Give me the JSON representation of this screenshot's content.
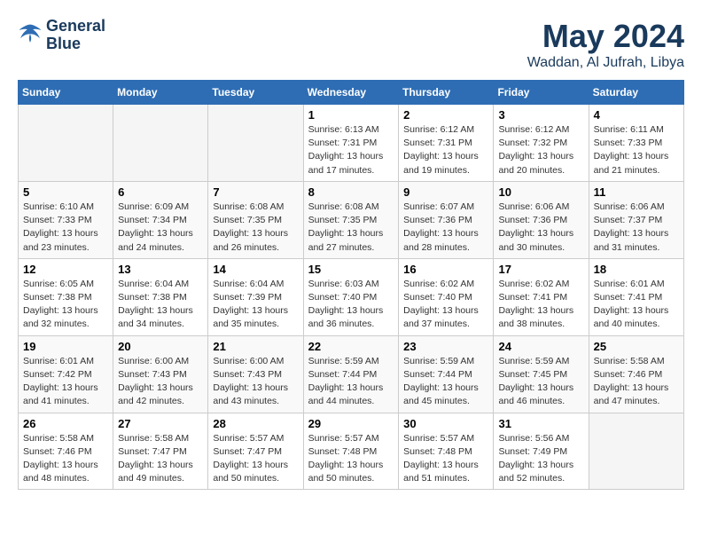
{
  "logo": {
    "line1": "General",
    "line2": "Blue"
  },
  "title": "May 2024",
  "location": "Waddan, Al Jufrah, Libya",
  "weekdays": [
    "Sunday",
    "Monday",
    "Tuesday",
    "Wednesday",
    "Thursday",
    "Friday",
    "Saturday"
  ],
  "weeks": [
    [
      {
        "day": "",
        "sunrise": "",
        "sunset": "",
        "daylight": ""
      },
      {
        "day": "",
        "sunrise": "",
        "sunset": "",
        "daylight": ""
      },
      {
        "day": "",
        "sunrise": "",
        "sunset": "",
        "daylight": ""
      },
      {
        "day": "1",
        "sunrise": "Sunrise: 6:13 AM",
        "sunset": "Sunset: 7:31 PM",
        "daylight": "Daylight: 13 hours and 17 minutes."
      },
      {
        "day": "2",
        "sunrise": "Sunrise: 6:12 AM",
        "sunset": "Sunset: 7:31 PM",
        "daylight": "Daylight: 13 hours and 19 minutes."
      },
      {
        "day": "3",
        "sunrise": "Sunrise: 6:12 AM",
        "sunset": "Sunset: 7:32 PM",
        "daylight": "Daylight: 13 hours and 20 minutes."
      },
      {
        "day": "4",
        "sunrise": "Sunrise: 6:11 AM",
        "sunset": "Sunset: 7:33 PM",
        "daylight": "Daylight: 13 hours and 21 minutes."
      }
    ],
    [
      {
        "day": "5",
        "sunrise": "Sunrise: 6:10 AM",
        "sunset": "Sunset: 7:33 PM",
        "daylight": "Daylight: 13 hours and 23 minutes."
      },
      {
        "day": "6",
        "sunrise": "Sunrise: 6:09 AM",
        "sunset": "Sunset: 7:34 PM",
        "daylight": "Daylight: 13 hours and 24 minutes."
      },
      {
        "day": "7",
        "sunrise": "Sunrise: 6:08 AM",
        "sunset": "Sunset: 7:35 PM",
        "daylight": "Daylight: 13 hours and 26 minutes."
      },
      {
        "day": "8",
        "sunrise": "Sunrise: 6:08 AM",
        "sunset": "Sunset: 7:35 PM",
        "daylight": "Daylight: 13 hours and 27 minutes."
      },
      {
        "day": "9",
        "sunrise": "Sunrise: 6:07 AM",
        "sunset": "Sunset: 7:36 PM",
        "daylight": "Daylight: 13 hours and 28 minutes."
      },
      {
        "day": "10",
        "sunrise": "Sunrise: 6:06 AM",
        "sunset": "Sunset: 7:36 PM",
        "daylight": "Daylight: 13 hours and 30 minutes."
      },
      {
        "day": "11",
        "sunrise": "Sunrise: 6:06 AM",
        "sunset": "Sunset: 7:37 PM",
        "daylight": "Daylight: 13 hours and 31 minutes."
      }
    ],
    [
      {
        "day": "12",
        "sunrise": "Sunrise: 6:05 AM",
        "sunset": "Sunset: 7:38 PM",
        "daylight": "Daylight: 13 hours and 32 minutes."
      },
      {
        "day": "13",
        "sunrise": "Sunrise: 6:04 AM",
        "sunset": "Sunset: 7:38 PM",
        "daylight": "Daylight: 13 hours and 34 minutes."
      },
      {
        "day": "14",
        "sunrise": "Sunrise: 6:04 AM",
        "sunset": "Sunset: 7:39 PM",
        "daylight": "Daylight: 13 hours and 35 minutes."
      },
      {
        "day": "15",
        "sunrise": "Sunrise: 6:03 AM",
        "sunset": "Sunset: 7:40 PM",
        "daylight": "Daylight: 13 hours and 36 minutes."
      },
      {
        "day": "16",
        "sunrise": "Sunrise: 6:02 AM",
        "sunset": "Sunset: 7:40 PM",
        "daylight": "Daylight: 13 hours and 37 minutes."
      },
      {
        "day": "17",
        "sunrise": "Sunrise: 6:02 AM",
        "sunset": "Sunset: 7:41 PM",
        "daylight": "Daylight: 13 hours and 38 minutes."
      },
      {
        "day": "18",
        "sunrise": "Sunrise: 6:01 AM",
        "sunset": "Sunset: 7:41 PM",
        "daylight": "Daylight: 13 hours and 40 minutes."
      }
    ],
    [
      {
        "day": "19",
        "sunrise": "Sunrise: 6:01 AM",
        "sunset": "Sunset: 7:42 PM",
        "daylight": "Daylight: 13 hours and 41 minutes."
      },
      {
        "day": "20",
        "sunrise": "Sunrise: 6:00 AM",
        "sunset": "Sunset: 7:43 PM",
        "daylight": "Daylight: 13 hours and 42 minutes."
      },
      {
        "day": "21",
        "sunrise": "Sunrise: 6:00 AM",
        "sunset": "Sunset: 7:43 PM",
        "daylight": "Daylight: 13 hours and 43 minutes."
      },
      {
        "day": "22",
        "sunrise": "Sunrise: 5:59 AM",
        "sunset": "Sunset: 7:44 PM",
        "daylight": "Daylight: 13 hours and 44 minutes."
      },
      {
        "day": "23",
        "sunrise": "Sunrise: 5:59 AM",
        "sunset": "Sunset: 7:44 PM",
        "daylight": "Daylight: 13 hours and 45 minutes."
      },
      {
        "day": "24",
        "sunrise": "Sunrise: 5:59 AM",
        "sunset": "Sunset: 7:45 PM",
        "daylight": "Daylight: 13 hours and 46 minutes."
      },
      {
        "day": "25",
        "sunrise": "Sunrise: 5:58 AM",
        "sunset": "Sunset: 7:46 PM",
        "daylight": "Daylight: 13 hours and 47 minutes."
      }
    ],
    [
      {
        "day": "26",
        "sunrise": "Sunrise: 5:58 AM",
        "sunset": "Sunset: 7:46 PM",
        "daylight": "Daylight: 13 hours and 48 minutes."
      },
      {
        "day": "27",
        "sunrise": "Sunrise: 5:58 AM",
        "sunset": "Sunset: 7:47 PM",
        "daylight": "Daylight: 13 hours and 49 minutes."
      },
      {
        "day": "28",
        "sunrise": "Sunrise: 5:57 AM",
        "sunset": "Sunset: 7:47 PM",
        "daylight": "Daylight: 13 hours and 50 minutes."
      },
      {
        "day": "29",
        "sunrise": "Sunrise: 5:57 AM",
        "sunset": "Sunset: 7:48 PM",
        "daylight": "Daylight: 13 hours and 50 minutes."
      },
      {
        "day": "30",
        "sunrise": "Sunrise: 5:57 AM",
        "sunset": "Sunset: 7:48 PM",
        "daylight": "Daylight: 13 hours and 51 minutes."
      },
      {
        "day": "31",
        "sunrise": "Sunrise: 5:56 AM",
        "sunset": "Sunset: 7:49 PM",
        "daylight": "Daylight: 13 hours and 52 minutes."
      },
      {
        "day": "",
        "sunrise": "",
        "sunset": "",
        "daylight": ""
      }
    ]
  ]
}
